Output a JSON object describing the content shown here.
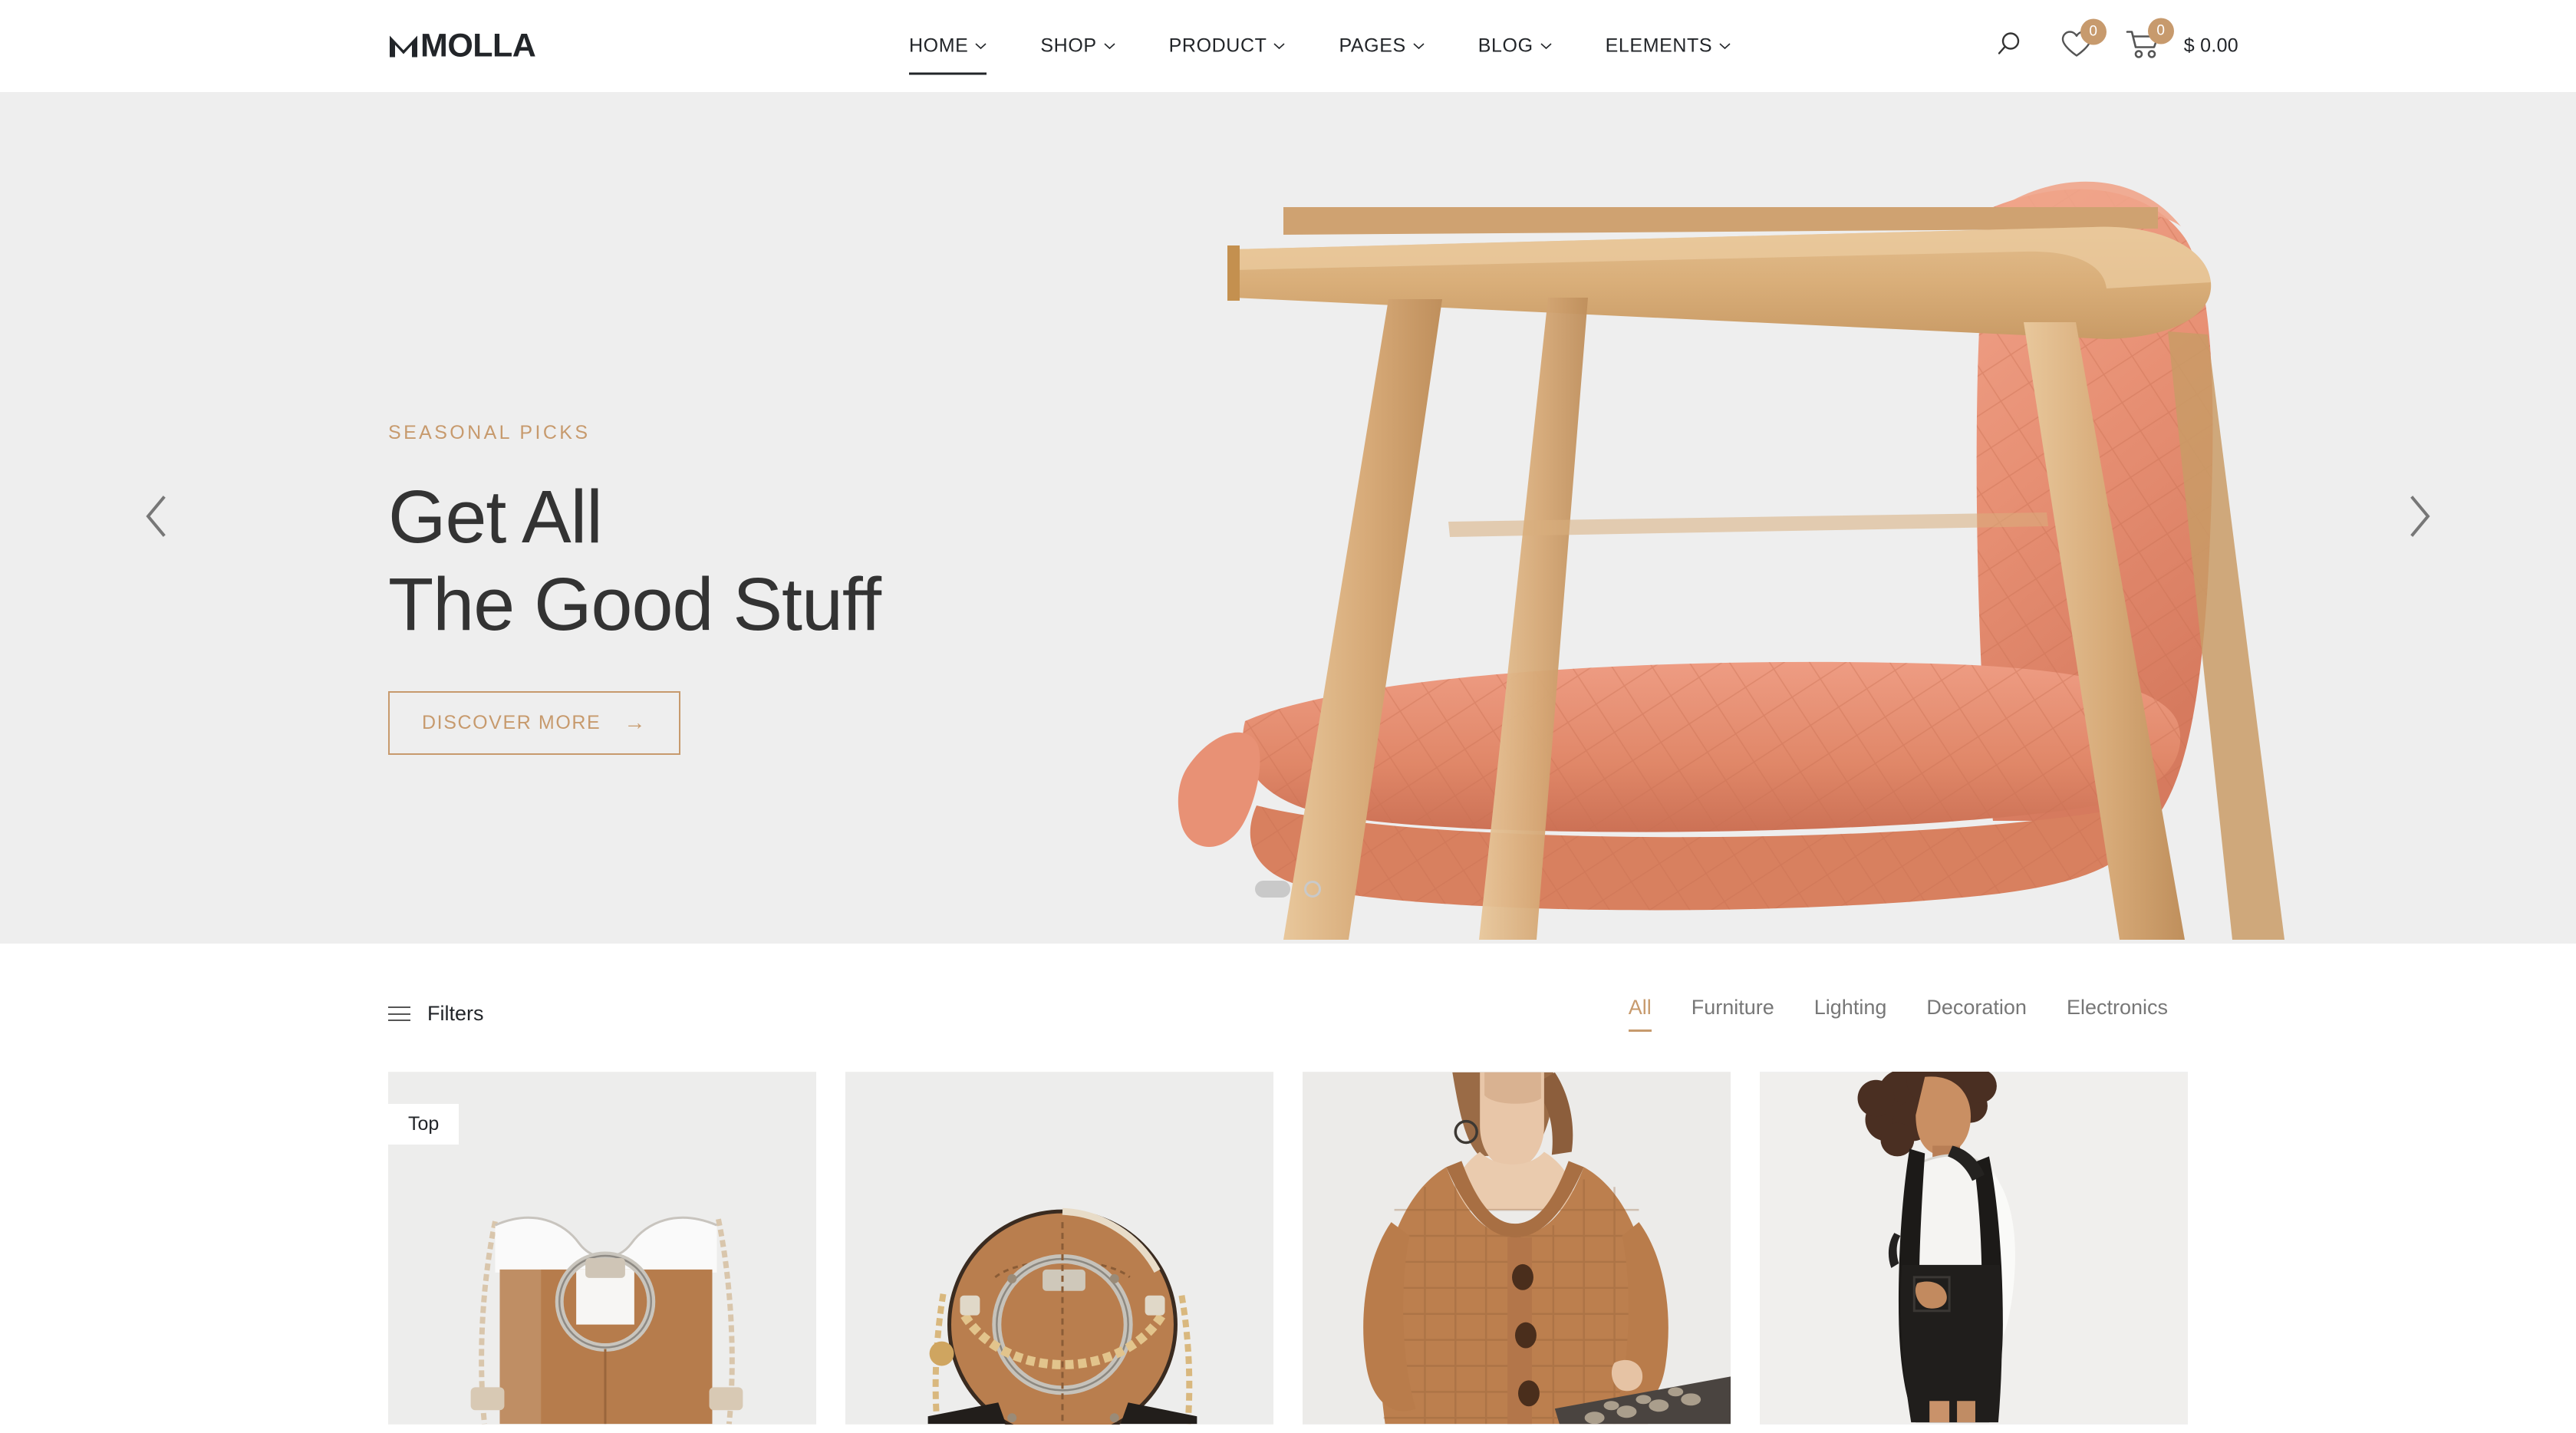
{
  "brand": {
    "name": "MOLLA"
  },
  "nav": {
    "items": [
      {
        "label": "HOME",
        "has_dropdown": true,
        "active": true
      },
      {
        "label": "SHOP",
        "has_dropdown": true,
        "active": false
      },
      {
        "label": "PRODUCT",
        "has_dropdown": true,
        "active": false
      },
      {
        "label": "PAGES",
        "has_dropdown": true,
        "active": false
      },
      {
        "label": "BLOG",
        "has_dropdown": true,
        "active": false
      },
      {
        "label": "ELEMENTS",
        "has_dropdown": true,
        "active": false
      }
    ]
  },
  "header_tools": {
    "search_icon": "search-icon",
    "wishlist_icon": "heart-icon",
    "wishlist_count": "0",
    "cart_icon": "cart-icon",
    "cart_count": "0",
    "cart_total": "$ 0.00"
  },
  "hero": {
    "eyebrow": "SEASONAL PICKS",
    "title_line1": "Get All",
    "title_line2": "The Good Stuff",
    "cta_label": "DISCOVER MORE",
    "cta_arrow": "→",
    "prev_icon": "chevron-left-icon",
    "next_icon": "chevron-right-icon",
    "slides": [
      {
        "index": "1",
        "active": true
      },
      {
        "index": "2",
        "active": false
      }
    ],
    "image_alt": "wooden armchair with coral quilted cushions"
  },
  "toolbar": {
    "filters_label": "Filters",
    "filters_icon": "hamburger-icon",
    "tabs": [
      {
        "label": "All",
        "active": true
      },
      {
        "label": "Furniture",
        "active": false
      },
      {
        "label": "Lighting",
        "active": false
      },
      {
        "label": "Decoration",
        "active": false
      },
      {
        "label": "Electronics",
        "active": false
      }
    ]
  },
  "products": [
    {
      "badge": "Top",
      "image_alt": "tan and white leather ring handbag with chain strap"
    },
    {
      "badge": "",
      "image_alt": "round tan crossbody bag with silver ring and gold chain"
    },
    {
      "badge": "",
      "image_alt": "model wearing camel knit cardigan and snakeskin skirt"
    },
    {
      "badge": "",
      "image_alt": "model wearing black pinafore dress over white top"
    }
  ],
  "colors": {
    "accent": "#C79A6D",
    "text_dark": "#222529",
    "text_muted": "#777777",
    "hero_bg": "#EEEEEE",
    "card_bg": "#F0F0F0"
  }
}
